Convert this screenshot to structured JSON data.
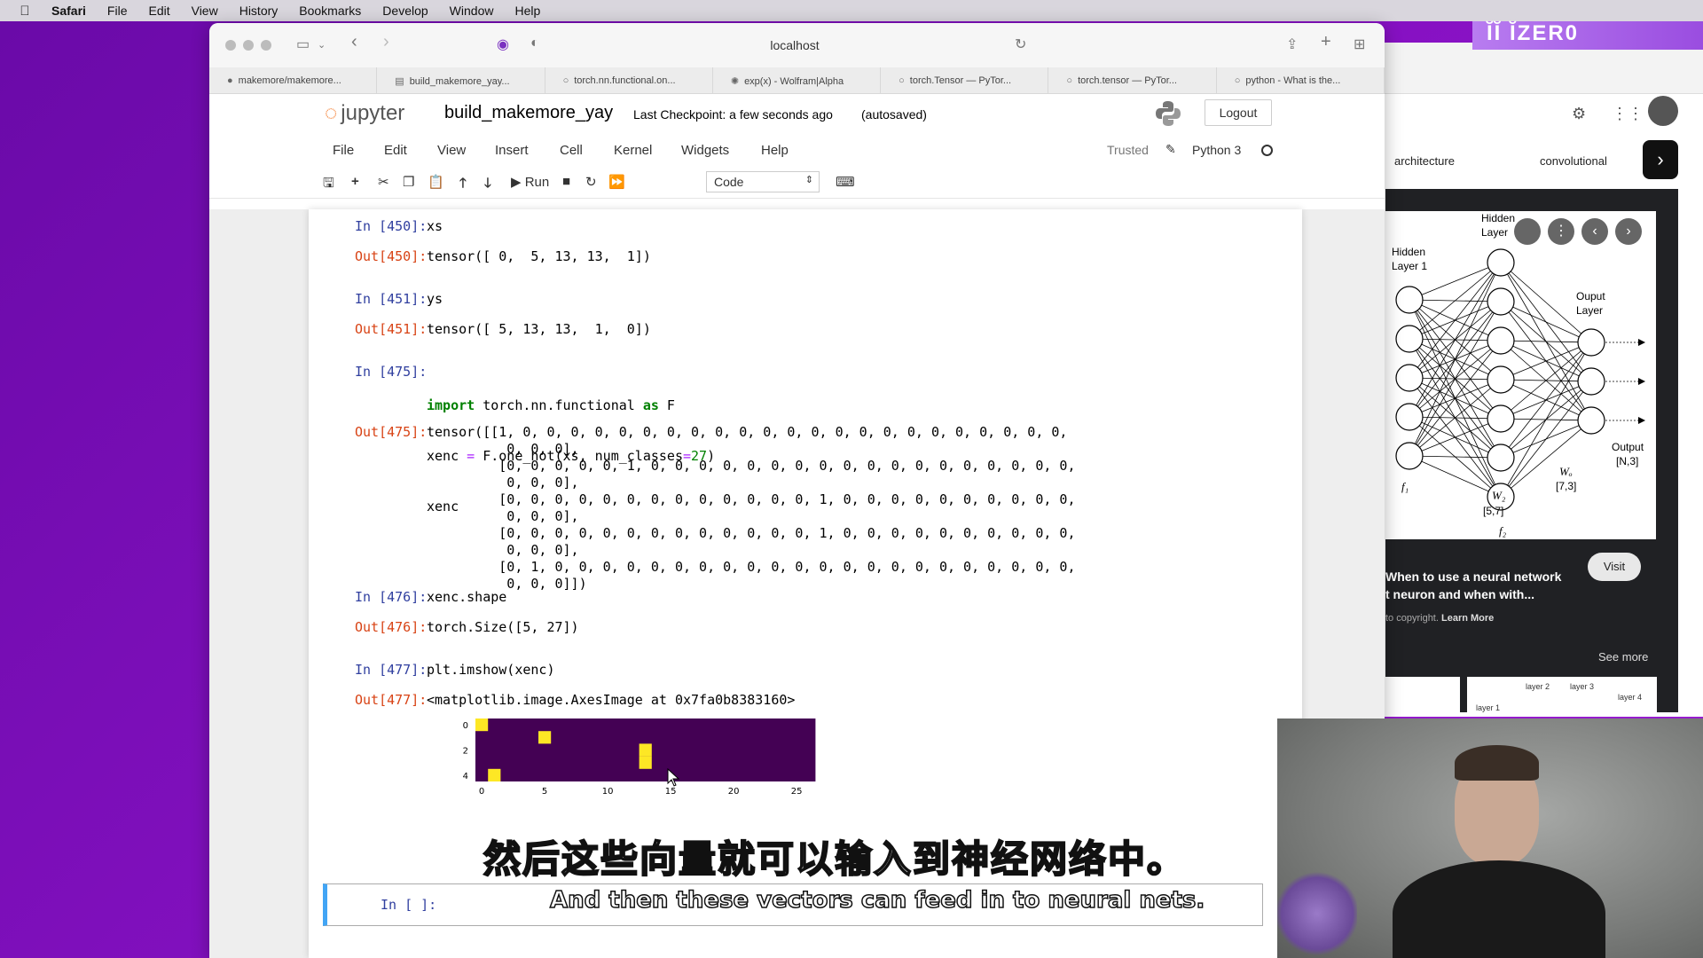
{
  "menubar": {
    "items": [
      "Safari",
      "File",
      "Edit",
      "View",
      "History",
      "Bookmarks",
      "Develop",
      "Window",
      "Help"
    ]
  },
  "browser": {
    "url": "localhost",
    "tabs": [
      "makemore/makemore...",
      "build_makemore_yay...",
      "torch.nn.functional.on...",
      "exp(x) - Wolfram|Alpha",
      "torch.Tensor — PyTor...",
      "torch.tensor — PyTor...",
      "python - What is the..."
    ]
  },
  "jupyter": {
    "logo_text": "jupyter",
    "notebook_name": "build_makemore_yay",
    "checkpoint": "Last Checkpoint: a few seconds ago",
    "autosave": "(autosaved)",
    "logout": "Logout",
    "menu": [
      "File",
      "Edit",
      "View",
      "Insert",
      "Cell",
      "Kernel",
      "Widgets",
      "Help"
    ],
    "trusted": "Trusted",
    "kernel": "Python 3",
    "run_label": "Run",
    "cell_type": "Code"
  },
  "cells": {
    "c450_in_prompt": "In [450]:",
    "c450_in": "xs",
    "c450_out_prompt": "Out[450]:",
    "c450_out": "tensor([ 0,  5, 13, 13,  1])",
    "c451_in_prompt": "In [451]:",
    "c451_in": "ys",
    "c451_out_prompt": "Out[451]:",
    "c451_out": "tensor([ 5, 13, 13,  1,  0])",
    "c475_in_prompt": "In [475]:",
    "c475_line1_kw1": "import",
    "c475_line1_mod": " torch.nn.functional ",
    "c475_line1_kw2": "as",
    "c475_line1_alias": " F",
    "c475_line2_a": "xenc ",
    "c475_line2_eq": "=",
    "c475_line2_b": " F.one_hot(xs, num_classes",
    "c475_line2_eq2": "=",
    "c475_line2_num": "27",
    "c475_line2_c": ")",
    "c475_line3": "xenc",
    "c475_out_prompt": "Out[475]:",
    "c475_out": "tensor([[1, 0, 0, 0, 0, 0, 0, 0, 0, 0, 0, 0, 0, 0, 0, 0, 0, 0, 0, 0, 0, 0, 0, 0,\n          0, 0, 0],\n         [0, 0, 0, 0, 0, 1, 0, 0, 0, 0, 0, 0, 0, 0, 0, 0, 0, 0, 0, 0, 0, 0, 0, 0,\n          0, 0, 0],\n         [0, 0, 0, 0, 0, 0, 0, 0, 0, 0, 0, 0, 0, 1, 0, 0, 0, 0, 0, 0, 0, 0, 0, 0,\n          0, 0, 0],\n         [0, 0, 0, 0, 0, 0, 0, 0, 0, 0, 0, 0, 0, 1, 0, 0, 0, 0, 0, 0, 0, 0, 0, 0,\n          0, 0, 0],\n         [0, 1, 0, 0, 0, 0, 0, 0, 0, 0, 0, 0, 0, 0, 0, 0, 0, 0, 0, 0, 0, 0, 0, 0,\n          0, 0, 0]])",
    "c476_in_prompt": "In [476]:",
    "c476_in": "xenc.shape",
    "c476_out_prompt": "Out[476]:",
    "c476_out": "torch.Size([5, 27])",
    "c477_in_prompt": "In [477]:",
    "c477_in": "plt.imshow(xenc)",
    "c477_out_prompt": "Out[477]:",
    "c477_out": "<matplotlib.image.AxesImage at 0x7fa0b8383160>",
    "empty_prompt": "In [ ]:"
  },
  "plot": {
    "y_ticks": [
      "0",
      "2",
      "4"
    ],
    "x_ticks": [
      "0",
      "5",
      "10",
      "15",
      "20",
      "25"
    ],
    "hot_columns": [
      0,
      5,
      13,
      13,
      1
    ],
    "bg_color": "#440154",
    "hot_color": "#fde725"
  },
  "side": {
    "chip1": "architecture",
    "chip2": "convolutional",
    "nn_labels": {
      "hidden1": "Hidden\nLayer 1",
      "hidden2": "Hidden\nLayer",
      "output_layer": "Ouput\nLayer",
      "output": "Output\n[N,3]",
      "w2": "W₂\n[5,7]",
      "wo": "Wₒ\n[7,3]",
      "f1": "f₁",
      "f2": "f₂"
    },
    "visit": "Visit",
    "result_title": "When to use a neural network\nt neuron and when with...",
    "copyright": "to copyright.",
    "learn_more": "Learn More",
    "see_more": "See more",
    "layer_labels": [
      "layer 1",
      "layer 2",
      "layer 3",
      "layer 4"
    ]
  },
  "subtitles": {
    "zh": "然后这些向量就可以输入到神经网络中。",
    "en": "And then these vectors can feed in to neural nets."
  }
}
